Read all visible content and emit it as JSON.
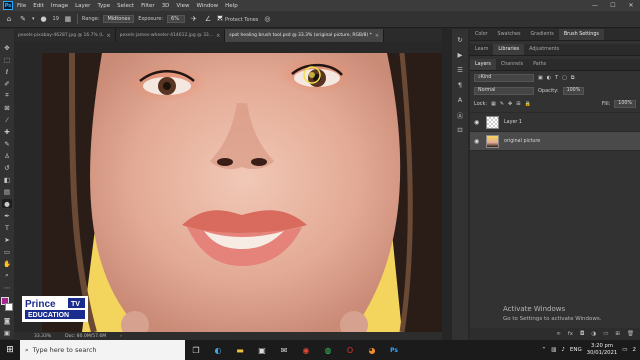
{
  "app": {
    "logo_text": "Ps"
  },
  "menu": [
    "File",
    "Edit",
    "Image",
    "Layer",
    "Type",
    "Select",
    "Filter",
    "3D",
    "View",
    "Window",
    "Help"
  ],
  "window_controls": {
    "minimize": "—",
    "maximize": "☐",
    "close": "✕"
  },
  "options": {
    "brush_size": "19",
    "range_label": "Range:",
    "range_value": "Midtones",
    "exposure_label": "Exposure:",
    "exposure_value": "6%",
    "protect_tones_label": "Protect Tones",
    "protect_tones_checked": true
  },
  "tabs": [
    {
      "label": "pexels-pixabay-46287.jpg @ 16.7% (L",
      "active": false
    },
    {
      "label": "pexels-james-wheeler-414612.jpg @ 33...",
      "active": false
    },
    {
      "label": "spot healing brush tool.psd @ 33.3% (original picture, RGB/8) *",
      "active": true
    }
  ],
  "tools": [
    "move-icon",
    "marquee-icon",
    "lasso-icon",
    "quick-select-icon",
    "crop-icon",
    "frame-icon",
    "eyedropper-icon",
    "healing-brush-icon",
    "brush-icon",
    "clone-stamp-icon",
    "history-brush-icon",
    "eraser-icon",
    "gradient-icon",
    "dodge-icon",
    "pen-icon",
    "type-icon",
    "path-select-icon",
    "rectangle-icon",
    "hand-icon",
    "zoom-icon",
    "more-icon"
  ],
  "colors": {
    "foreground": "#a3278f",
    "background": "#ffffff",
    "accent": "#31a8ff"
  },
  "status": {
    "zoom": "33.33%",
    "doc": "Doc: 80.0M/57.6M"
  },
  "panel_top": {
    "tabs": [
      "Color",
      "Swatches",
      "Gradients",
      "Brush Settings"
    ],
    "active": "Brush Settings"
  },
  "panel_mid": {
    "tabs": [
      "Learn",
      "Libraries",
      "Adjustments"
    ],
    "active": "Libraries"
  },
  "layers_panel": {
    "tabs": [
      "Layers",
      "Channels",
      "Paths"
    ],
    "active": "Layers",
    "filter_kind": "Kind",
    "blend_mode": "Normal",
    "opacity_label": "Opacity:",
    "opacity_value": "100%",
    "lock_label": "Lock:",
    "fill_label": "Fill:",
    "fill_value": "100%",
    "layers": [
      {
        "name": "Layer 1",
        "selected": false,
        "visible": true
      },
      {
        "name": "original picture",
        "selected": true,
        "visible": true
      }
    ],
    "footer_icons": [
      "link-icon",
      "fx-icon",
      "mask-icon",
      "adjustment-icon",
      "group-icon",
      "new-layer-icon",
      "trash-icon"
    ]
  },
  "watermark": {
    "line1": "Activate Windows",
    "line2": "Go to Settings to activate Windows."
  },
  "brand_logo": {
    "line1": "Prince",
    "line2": "EDUCATION",
    "badge": "TV"
  },
  "taskbar": {
    "search_placeholder": "Type here to search",
    "apps": [
      "task-view-icon",
      "edge-icon",
      "file-explorer-icon",
      "store-icon",
      "mail-icon",
      "chrome-icon",
      "whatsapp-icon",
      "opera-icon",
      "firefox-icon",
      "photoshop-icon"
    ],
    "tray": {
      "lang": "ENG",
      "time": "3:20 pm",
      "date": "30/01/2021",
      "notif": "2"
    }
  }
}
